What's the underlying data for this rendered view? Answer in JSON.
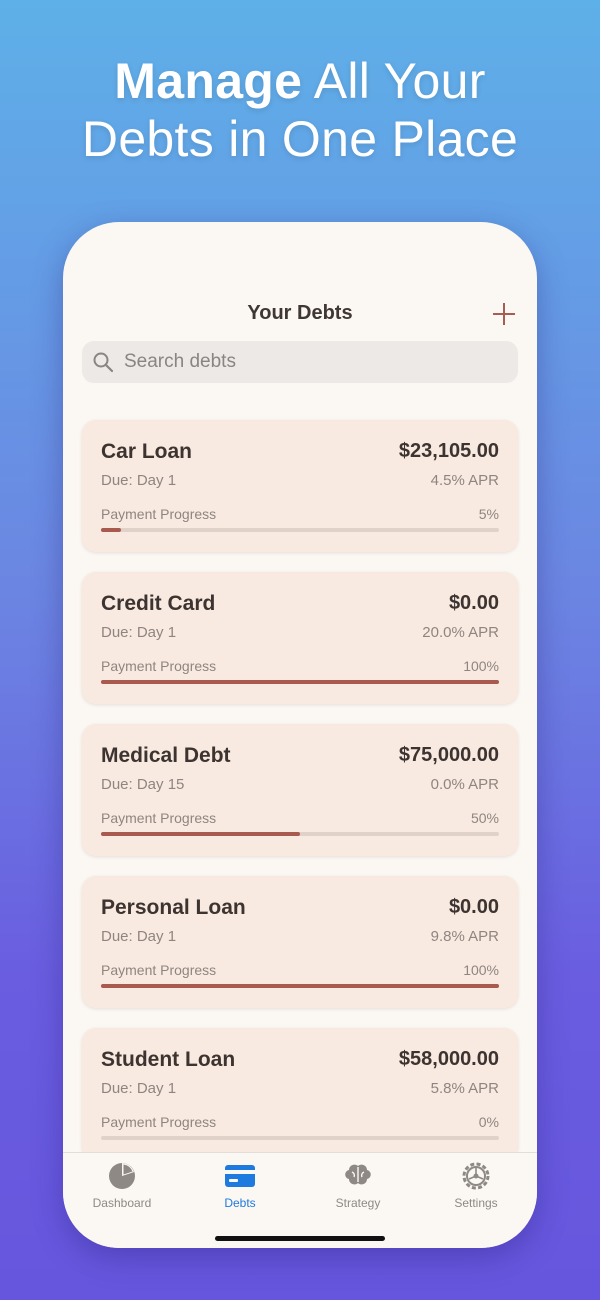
{
  "headline": {
    "bold": "Manage",
    "rest_line1": " All Your",
    "line2": "Debts in One Place"
  },
  "nav": {
    "title": "Your Debts",
    "add_icon": "plus-icon"
  },
  "search": {
    "placeholder": "Search debts",
    "value": "",
    "icon": "search-icon"
  },
  "debts": [
    {
      "name": "Car Loan",
      "amount": "$23,105.00",
      "due": "Due: Day 1",
      "apr": "4.5% APR",
      "progress_label": "Payment Progress",
      "progress_text": "5%",
      "progress": 5
    },
    {
      "name": "Credit Card",
      "amount": "$0.00",
      "due": "Due: Day 1",
      "apr": "20.0% APR",
      "progress_label": "Payment Progress",
      "progress_text": "100%",
      "progress": 100
    },
    {
      "name": "Medical Debt",
      "amount": "$75,000.00",
      "due": "Due: Day 15",
      "apr": "0.0% APR",
      "progress_label": "Payment Progress",
      "progress_text": "50%",
      "progress": 50
    },
    {
      "name": "Personal Loan",
      "amount": "$0.00",
      "due": "Due: Day 1",
      "apr": "9.8% APR",
      "progress_label": "Payment Progress",
      "progress_text": "100%",
      "progress": 100
    },
    {
      "name": "Student Loan",
      "amount": "$58,000.00",
      "due": "Due: Day 1",
      "apr": "5.8% APR",
      "progress_label": "Payment Progress",
      "progress_text": "0%",
      "progress": 0
    }
  ],
  "tabs": [
    {
      "label": "Dashboard",
      "icon": "pie-chart-icon",
      "active": false
    },
    {
      "label": "Debts",
      "icon": "credit-card-icon",
      "active": true
    },
    {
      "label": "Strategy",
      "icon": "brain-icon",
      "active": false
    },
    {
      "label": "Settings",
      "icon": "gear-icon",
      "active": false
    }
  ],
  "colors": {
    "accent": "#1f7ae0",
    "progress": "#a85a4e",
    "card": "#f8eae0",
    "tab_inactive": "#8e8985"
  }
}
